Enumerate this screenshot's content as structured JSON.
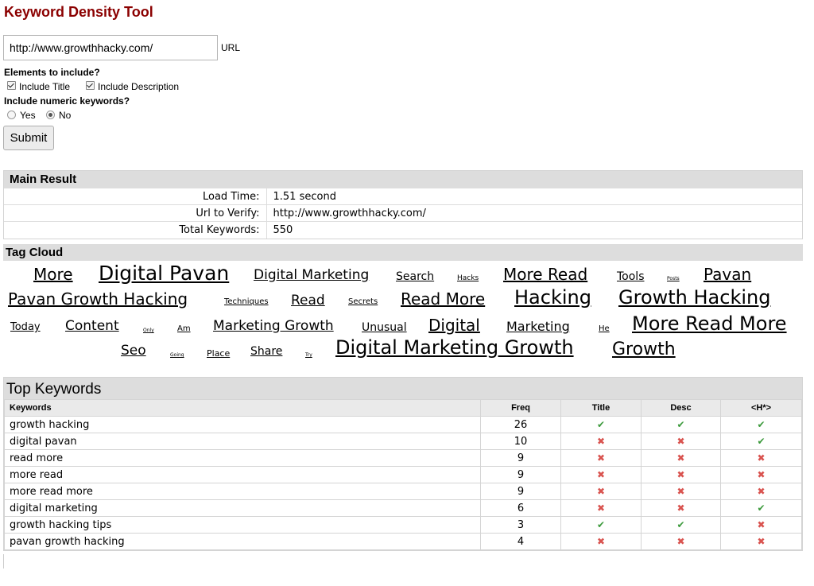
{
  "page": {
    "title": "Keyword Density Tool"
  },
  "form": {
    "url_value": "http://www.growthhacky.com/",
    "url_label": "URL",
    "elements_label": "Elements to include?",
    "include_title": "Include Title",
    "include_description": "Include Description",
    "numeric_label": "Include numeric keywords?",
    "yes": "Yes",
    "no": "No",
    "submit": "Submit"
  },
  "main_result": {
    "heading": "Main Result",
    "rows": [
      {
        "label": "Load Time:",
        "value": "1.51 second"
      },
      {
        "label": "Url to Verify:",
        "value": "http://www.growthhacky.com/"
      },
      {
        "label": "Total Keywords:",
        "value": "550"
      }
    ]
  },
  "tag_cloud": {
    "heading": "Tag Cloud",
    "tags": [
      "More",
      "Digital Pavan",
      "Digital Marketing",
      "Search",
      "Hacks",
      "More Read",
      "Tools",
      "Posts",
      "Pavan",
      "Pavan Growth Hacking",
      "Techniques",
      "Read",
      "Secrets",
      "Read More",
      "Hacking",
      "Growth Hacking",
      "Today",
      "Content",
      "Only",
      "Am",
      "Marketing Growth",
      "Unusual",
      "Digital",
      "Marketing",
      "He",
      "More Read More",
      "Seo",
      "Going",
      "Place",
      "Share",
      "Try",
      "Digital Marketing Growth",
      "Growth"
    ]
  },
  "top_keywords": {
    "heading": "Top Keywords",
    "columns": [
      "Keywords",
      "Freq",
      "Title",
      "Desc",
      "<H*>"
    ],
    "rows": [
      {
        "keyword": "growth hacking",
        "freq": "26",
        "title": "yes",
        "desc": "yes",
        "h": "yes"
      },
      {
        "keyword": "digital pavan",
        "freq": "10",
        "title": "no",
        "desc": "no",
        "h": "yes"
      },
      {
        "keyword": "read more",
        "freq": "9",
        "title": "no",
        "desc": "no",
        "h": "no"
      },
      {
        "keyword": "more read",
        "freq": "9",
        "title": "no",
        "desc": "no",
        "h": "no"
      },
      {
        "keyword": "more read more",
        "freq": "9",
        "title": "no",
        "desc": "no",
        "h": "no"
      },
      {
        "keyword": "digital marketing",
        "freq": "6",
        "title": "no",
        "desc": "no",
        "h": "yes"
      },
      {
        "keyword": "growth hacking tips",
        "freq": "3",
        "title": "yes",
        "desc": "yes",
        "h": "no"
      },
      {
        "keyword": "pavan growth hacking",
        "freq": "4",
        "title": "no",
        "desc": "no",
        "h": "no"
      }
    ]
  },
  "icons": {
    "check": "check-icon",
    "cross": "cross-icon"
  },
  "colors": {
    "title": "#8b0000",
    "check": "#3c9a3c",
    "cross": "#d9534f",
    "header_bg": "#dddddd"
  }
}
